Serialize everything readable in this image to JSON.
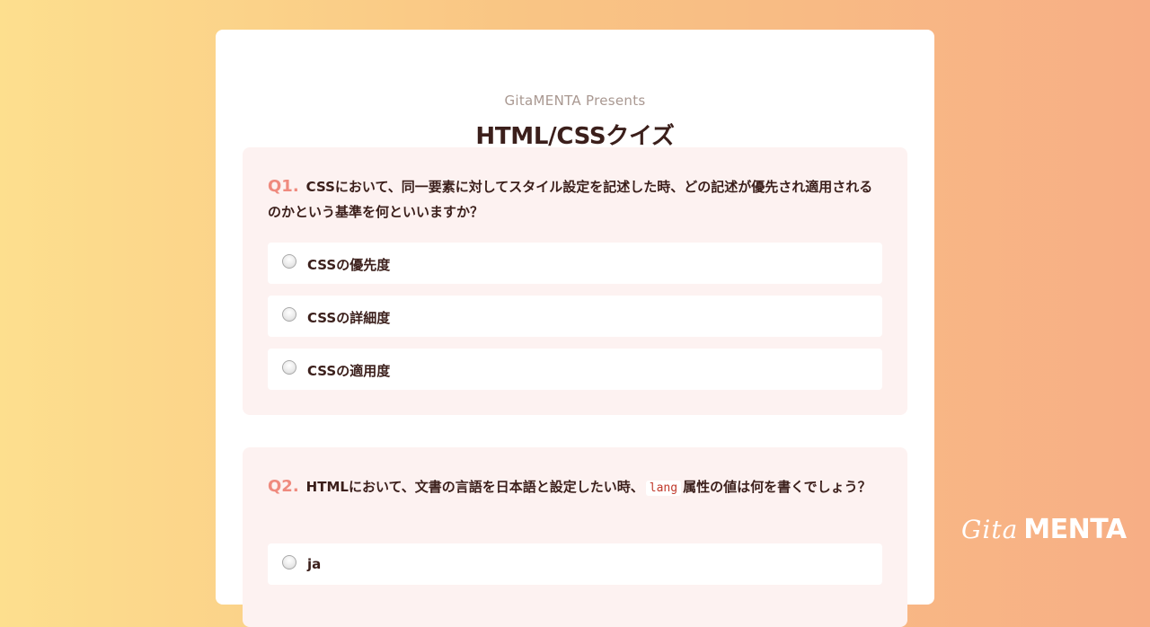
{
  "header": {
    "presents": "GitaMENTA Presents",
    "title": "HTML/CSSクイズ"
  },
  "questions": [
    {
      "number": "Q1.",
      "text": "CSSにおいて、同一要素に対してスタイル設定を記述した時、どの記述が優先され適用されるのかという基準を何といいますか？",
      "options": [
        "CSSの優先度",
        "CSSの詳細度",
        "CSSの適用度"
      ]
    },
    {
      "number": "Q2.",
      "text_before": "HTMLにおいて、文書の言語を日本語と設定したい時、",
      "code": "lang",
      "text_after": "属性の値は何を書くでしょう？",
      "options": [
        "ja"
      ]
    }
  ],
  "logo": {
    "gita": "Gita",
    "menta": "MENTA"
  }
}
